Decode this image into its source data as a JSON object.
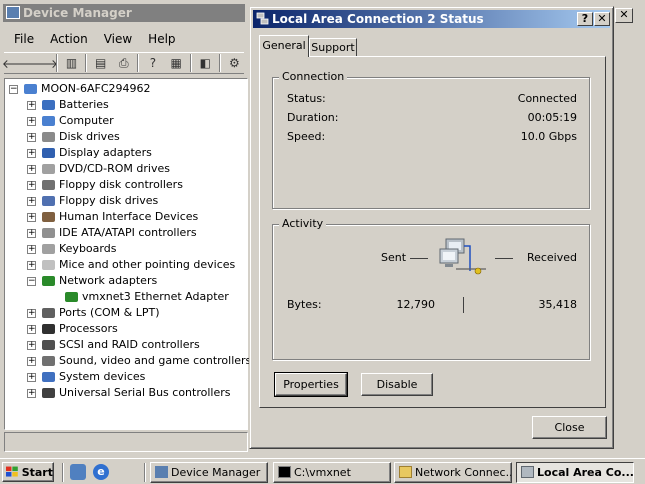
{
  "device_manager": {
    "title": "Device Manager",
    "menu": [
      "File",
      "Action",
      "View",
      "Help"
    ],
    "tree": {
      "root": "MOON-6AFC294962",
      "items": [
        {
          "label": "Batteries",
          "icon": "battery-icon",
          "color": "#3b6fc0"
        },
        {
          "label": "Computer",
          "icon": "computer-icon",
          "color": "#4a80d0"
        },
        {
          "label": "Disk drives",
          "icon": "disk-drive-icon",
          "color": "#8a8a8a"
        },
        {
          "label": "Display adapters",
          "icon": "display-adapter-icon",
          "color": "#3060b0"
        },
        {
          "label": "DVD/CD-ROM drives",
          "icon": "dvd-drive-icon",
          "color": "#a0a0a0"
        },
        {
          "label": "Floppy disk controllers",
          "icon": "floppy-controller-icon",
          "color": "#707070"
        },
        {
          "label": "Floppy disk drives",
          "icon": "floppy-drive-icon",
          "color": "#5070b0"
        },
        {
          "label": "Human Interface Devices",
          "icon": "hid-icon",
          "color": "#806040"
        },
        {
          "label": "IDE ATA/ATAPI controllers",
          "icon": "ide-controller-icon",
          "color": "#909090"
        },
        {
          "label": "Keyboards",
          "icon": "keyboard-icon",
          "color": "#a0a0a0"
        },
        {
          "label": "Mice and other pointing devices",
          "icon": "mouse-icon",
          "color": "#c0c0c0"
        },
        {
          "label": "Network adapters",
          "icon": "network-adapter-icon",
          "color": "#2a8a2a",
          "expanded": true,
          "children": [
            {
              "label": "vmxnet3 Ethernet Adapter",
              "icon": "network-card-icon",
              "color": "#2a8a2a"
            }
          ]
        },
        {
          "label": "Ports (COM & LPT)",
          "icon": "port-icon",
          "color": "#606060"
        },
        {
          "label": "Processors",
          "icon": "processor-icon",
          "color": "#303030"
        },
        {
          "label": "SCSI and RAID controllers",
          "icon": "scsi-icon",
          "color": "#505050"
        },
        {
          "label": "Sound, video and game controllers",
          "icon": "sound-icon",
          "color": "#707070"
        },
        {
          "label": "System devices",
          "icon": "system-device-icon",
          "color": "#4070c0"
        },
        {
          "label": "Universal Serial Bus controllers",
          "icon": "usb-icon",
          "color": "#404040"
        }
      ]
    }
  },
  "dialog": {
    "title": "Local Area Connection 2 Status",
    "tabs": [
      "General",
      "Support"
    ],
    "connection": {
      "label": "Connection",
      "status_label": "Status:",
      "status_value": "Connected",
      "duration_label": "Duration:",
      "duration_value": "00:05:19",
      "speed_label": "Speed:",
      "speed_value": "10.0 Gbps"
    },
    "activity": {
      "label": "Activity",
      "sent_label": "Sent",
      "received_label": "Received",
      "bytes_label": "Bytes:",
      "bytes_sent": "12,790",
      "bytes_received": "35,418"
    },
    "buttons": {
      "properties": "Properties",
      "disable": "Disable",
      "close": "Close"
    }
  },
  "taskbar": {
    "start": "Start",
    "tasks": [
      {
        "label": "Device Manager"
      },
      {
        "label": "C:\\vmxnet"
      },
      {
        "label": "Network Connec..."
      },
      {
        "label": "Local Area Co...",
        "active": true
      }
    ]
  }
}
